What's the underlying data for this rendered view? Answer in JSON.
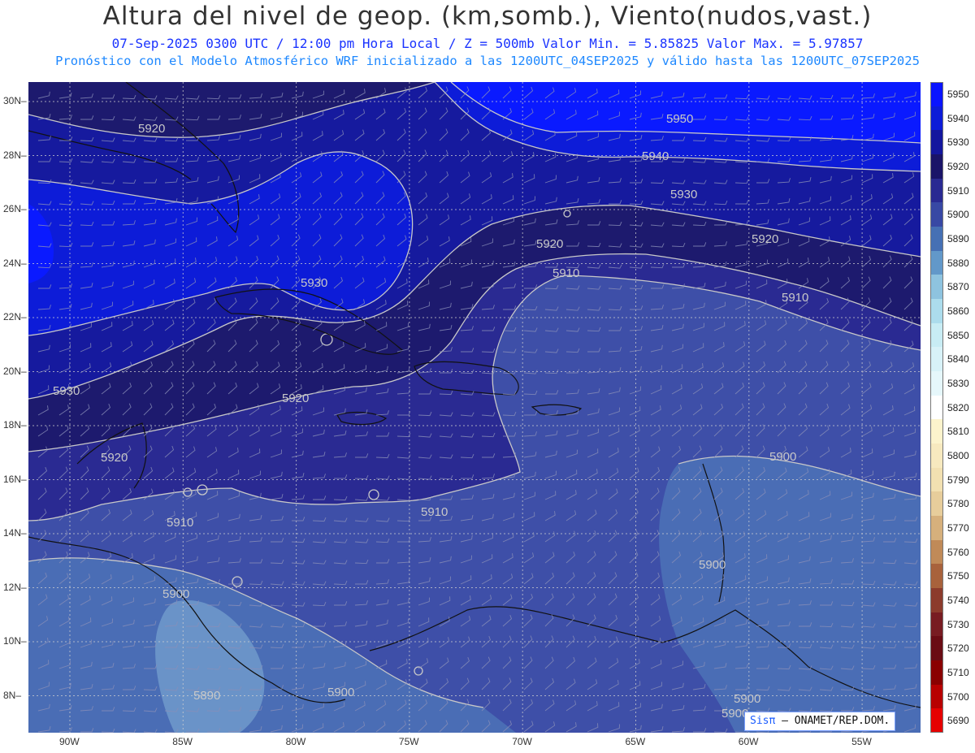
{
  "header": {
    "title": "Altura del nivel de geop. (km,somb.), Viento(nudos,vast.)",
    "subtitle": "07-Sep-2025  0300 UTC / 12:00 pm Hora Local / Z = 500mb   Valor Min. = 5.85825  Valor Max. = 5.97857",
    "subtitle2": "Pronóstico con el Modelo Atmosférico WRF inicializado a las 1200UTC_04SEP2025 y válido hasta las  1200UTC_07SEP2025"
  },
  "map": {
    "lat_labels": [
      "30N",
      "28N",
      "26N",
      "24N",
      "22N",
      "20N",
      "18N",
      "16N",
      "14N",
      "12N",
      "10N",
      "8N"
    ],
    "lon_labels": [
      "90W",
      "85W",
      "80W",
      "75W",
      "70W",
      "65W",
      "60W",
      "55W"
    ],
    "contour_labels": [
      "5920",
      "5950",
      "5940",
      "5930",
      "5920",
      "5930",
      "5920",
      "5910",
      "5910",
      "5930",
      "5920",
      "5920",
      "5900",
      "5910",
      "5910",
      "5900",
      "5900",
      "5890",
      "5900",
      "5900",
      "5900"
    ],
    "fill_colors": {
      "c5950": "#0a1aff",
      "c5940": "#0d1cd8",
      "c5930": "#161a9e",
      "c5920": "#1d1a6e",
      "c5910": "#2a2a92",
      "c5900": "#3e4fa8",
      "c5890": "#5a82bd"
    },
    "land_color": "#111111",
    "contour_color": "#c8c8c8"
  },
  "colorbar": {
    "levels": [
      "5950",
      "5940",
      "5930",
      "5920",
      "5910",
      "5900",
      "5890",
      "5880",
      "5870",
      "5860",
      "5850",
      "5840",
      "5830",
      "5820",
      "5810",
      "5800",
      "5790",
      "5780",
      "5770",
      "5760",
      "5750",
      "5740",
      "5730",
      "5720",
      "5710",
      "5700",
      "5690"
    ],
    "colors": [
      "#0a14ff",
      "#0d1cd8",
      "#14179e",
      "#1a1468",
      "#2a2a92",
      "#3848a4",
      "#4670b4",
      "#6298c9",
      "#8ec3df",
      "#acdcec",
      "#c8ecf4",
      "#d8f2f8",
      "#e6f7fb",
      "#ffffff",
      "#fcf3cc",
      "#f7e9bf",
      "#f2e0b1",
      "#e7cd9b",
      "#d6b07c",
      "#c08a58",
      "#a8623c",
      "#8c3b2c",
      "#781c22",
      "#6a0c14",
      "#8a0000",
      "#b80000",
      "#e60000"
    ]
  },
  "credit": {
    "brand": "Sisπ",
    "text": "–  ONAMET/REP.DOM."
  }
}
